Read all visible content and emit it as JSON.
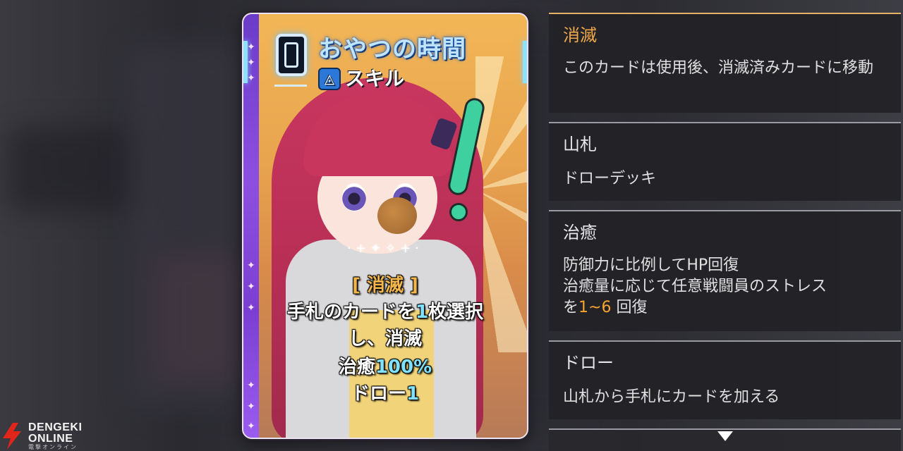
{
  "card": {
    "cost": "0",
    "title": "おやつの時間",
    "type_label": "スキル",
    "type_icon": "skill-icon",
    "sparkles": "·+✦✧+·",
    "keyword": "[ 消滅 ]",
    "line1_pre": "手札のカードを",
    "line1_num": "1",
    "line1_post": "枚選択",
    "line2": "し、消滅",
    "line3_pre": "治癒",
    "line3_num": "100%",
    "line4_pre": "ドロー",
    "line4_num": "1",
    "colors": {
      "keyword": "#f3b64a",
      "highlight": "#7fe0ff",
      "rail": "#8e4fe0"
    }
  },
  "panels": [
    {
      "title": "消滅",
      "desc": "このカードは使用後、消滅済みカードに移動",
      "active": true
    },
    {
      "title": "山札",
      "desc": "ドローデッキ",
      "active": false
    },
    {
      "title": "治癒",
      "desc_l1": "防御力に比例してHP回復",
      "desc_l2": "治癒量に応じて任意戦闘員のストレス",
      "desc_l3_pre": "を",
      "desc_l3_range": "1~6",
      "desc_l3_post": " 回復",
      "active": false
    },
    {
      "title": "ドロー",
      "desc": "山札から手札にカードを加える",
      "active": false
    }
  ],
  "watermark": {
    "line1": "DENGEKI",
    "line2": "ONLINE",
    "line3": "電撃オンライン"
  },
  "colors": {
    "accent_orange": "#f0a84a",
    "range_orange": "#f7a431",
    "panel_bg": "#222226"
  }
}
